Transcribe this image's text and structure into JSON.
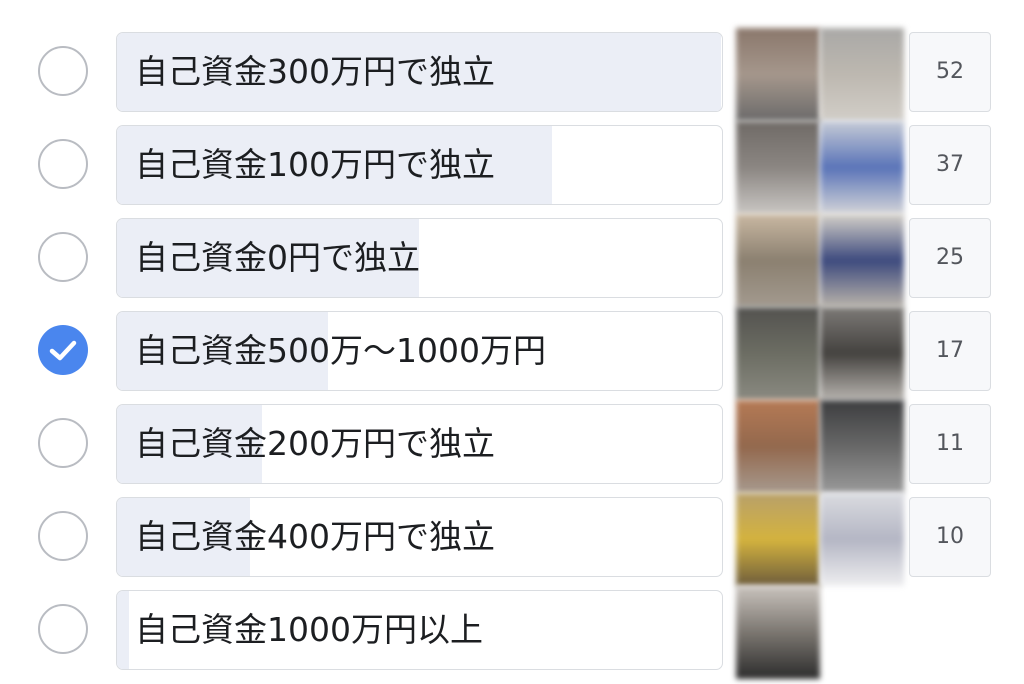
{
  "poll": {
    "options": [
      {
        "label": "自己資金300万円で独立",
        "votes": "52",
        "fill_fraction": 1.0,
        "checked": false,
        "voter_colors": [
          [
            "#8a776b",
            "#a5978c",
            "#6b6a6a"
          ],
          [
            "#a9a8a6",
            "#bdb8b0",
            "#d2cec8"
          ]
        ]
      },
      {
        "label": "自己資金100万円で独立",
        "votes": "37",
        "fill_fraction": 0.72,
        "checked": false,
        "voter_colors": [
          [
            "#6f6a66",
            "#8b8682",
            "#c9c6c3"
          ],
          [
            "#c6cbd6",
            "#5a74b8",
            "#d3d4d8"
          ]
        ]
      },
      {
        "label": "自己資金0円で独立",
        "votes": "25",
        "fill_fraction": 0.5,
        "checked": false,
        "voter_colors": [
          [
            "#c9b8a2",
            "#8b8070",
            "#a39a8f"
          ],
          [
            "#d5d1c9",
            "#3d4a7e",
            "#b9b3aa"
          ]
        ]
      },
      {
        "label": "自己資金500万〜1000万円",
        "votes": "17",
        "fill_fraction": 0.35,
        "checked": true,
        "voter_colors": [
          [
            "#53524f",
            "#6c6d63",
            "#8a8a81"
          ],
          [
            "#7d7a77",
            "#44423f",
            "#b7b3ae"
          ]
        ]
      },
      {
        "label": "自己資金200万円で独立",
        "votes": "11",
        "fill_fraction": 0.24,
        "checked": false,
        "voter_colors": [
          [
            "#b57a55",
            "#93684d",
            "#a79a8e"
          ],
          [
            "#3c3d3f",
            "#686868",
            "#9a9a9a"
          ]
        ]
      },
      {
        "label": "自己資金400万円で独立",
        "votes": "10",
        "fill_fraction": 0.22,
        "checked": false,
        "voter_colors": [
          [
            "#b8a06a",
            "#d4b33e",
            "#6e5d3c"
          ],
          [
            "#dadbe0",
            "#b4b6c4",
            "#eeeef0"
          ]
        ]
      },
      {
        "label": "自己資金1000万円以上",
        "votes": "",
        "fill_fraction": 0.02,
        "checked": false,
        "voter_colors": [
          [
            "#c9c3bd",
            "#7b7670",
            "#2c2c2c"
          ]
        ]
      }
    ]
  },
  "colors": {
    "check_fill": "#4a86ee",
    "bar_fill": "#ebeef6",
    "border": "#dadde1"
  }
}
